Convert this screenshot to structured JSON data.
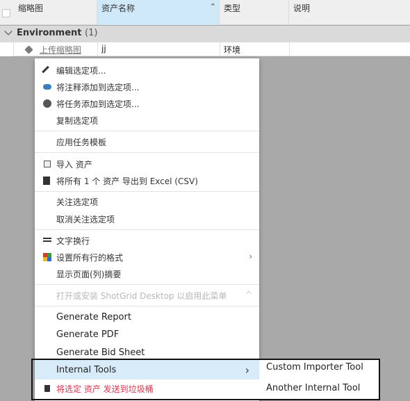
{
  "grid": {
    "columns": {
      "thumbnail": "缩略图",
      "asset_name": "资产名称",
      "type": "类型",
      "description": "说明"
    },
    "sort_indicator": "⌃",
    "group": {
      "name": "Environment",
      "count": "(1)"
    },
    "row": {
      "thumbnail_link": "上传缩略图",
      "asset_name": "jj",
      "type": "环境"
    }
  },
  "context_menu": {
    "edit_selected": "编辑选定项...",
    "add_note": "将注释添加到选定项...",
    "add_task": "将任务添加到选定项...",
    "copy_selected": "复制选定项",
    "apply_task_template": "应用任务模板",
    "import_assets": "导入 资产",
    "export_all": "将所有 1 个 资产 导出到 Excel (CSV)",
    "follow_selected": "关注选定项",
    "unfollow_selected": "取消关注选定项",
    "word_wrap": "文字换行",
    "format_all_rows": "设置所有行的格式",
    "show_page_summary": "显示页面(列)摘要",
    "shotgrid_desktop_hint": "打开或安装 ShotGrid Desktop 以启用此菜单",
    "generate_report": "Generate Report",
    "generate_pdf": "Generate PDF",
    "generate_bid_sheet": "Generate Bid Sheet",
    "internal_tools": "Internal Tools",
    "send_to_trash": "将选定 资产 发送到垃圾桶",
    "submenu_arrow": "›",
    "collapse_arrow": "^"
  },
  "submenu": {
    "custom_importer_tool": "Custom Importer Tool",
    "another_internal_tool": "Another Internal Tool"
  },
  "colors": {
    "accent_header": "#cfe9f9",
    "hover": "#d8ebf8",
    "danger": "#e0334e"
  },
  "icons": [
    "pencil-icon",
    "note-icon",
    "task-icon",
    "import-icon",
    "export-icon",
    "wrap-text-icon",
    "format-grid-icon",
    "trash-icon",
    "chevron-down-icon",
    "asset-cube-icon"
  ]
}
